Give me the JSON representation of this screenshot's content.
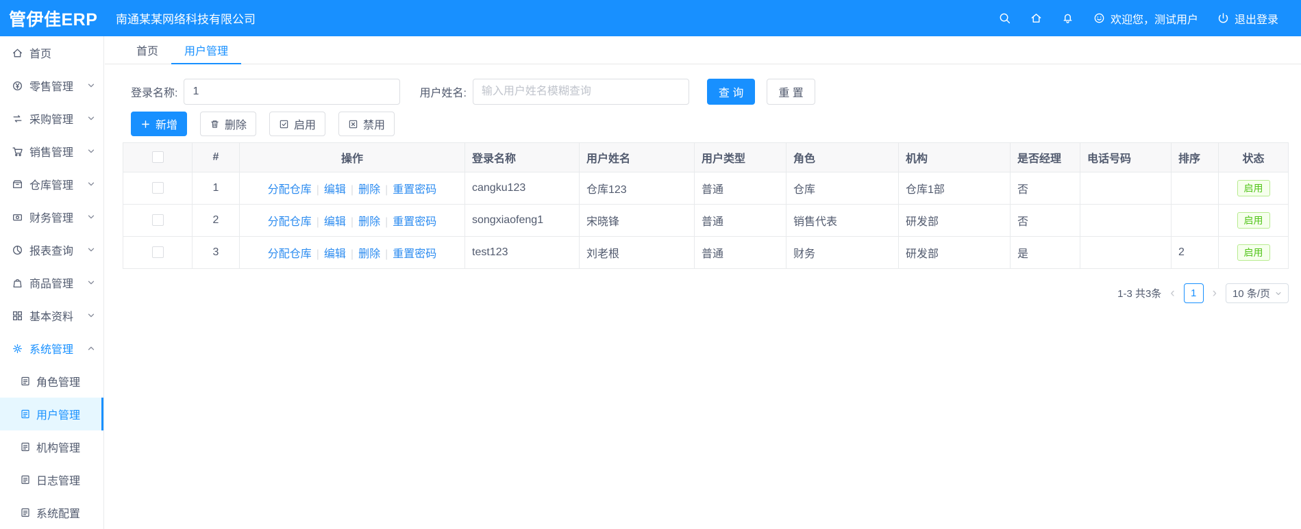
{
  "colors": {
    "primary": "#1890ff",
    "header_bg": "#1890ff",
    "success_text": "#52c41a",
    "active_menu_bg": "#e6f7ff"
  },
  "header": {
    "logo": "管伊佳ERP",
    "company": "南通某某网络科技有限公司",
    "icons": [
      "search-icon",
      "home-icon",
      "bell-icon",
      "smiley-icon",
      "power-icon"
    ],
    "welcome": "欢迎您，测试用户",
    "logout": "退出登录"
  },
  "sidebar": {
    "items": [
      {
        "label": "首页",
        "icon": "home-icon"
      },
      {
        "label": "零售管理",
        "icon": "retail-icon"
      },
      {
        "label": "采购管理",
        "icon": "purchase-icon"
      },
      {
        "label": "销售管理",
        "icon": "sales-cart-icon"
      },
      {
        "label": "仓库管理",
        "icon": "warehouse-icon"
      },
      {
        "label": "财务管理",
        "icon": "finance-icon"
      },
      {
        "label": "报表查询",
        "icon": "report-icon"
      },
      {
        "label": "商品管理",
        "icon": "goods-icon"
      },
      {
        "label": "基本资料",
        "icon": "basic-data-icon"
      },
      {
        "label": "系统管理",
        "icon": "gear-icon",
        "expanded": true,
        "active": true
      }
    ],
    "system_children": [
      {
        "label": "角色管理"
      },
      {
        "label": "用户管理",
        "active": true
      },
      {
        "label": "机构管理"
      },
      {
        "label": "日志管理"
      },
      {
        "label": "系统配置"
      }
    ]
  },
  "tabs": [
    {
      "label": "首页",
      "active": false
    },
    {
      "label": "用户管理",
      "active": true
    }
  ],
  "filters": {
    "login_label": "登录名称:",
    "login_value": "1",
    "name_label": "用户姓名:",
    "name_placeholder": "输入用户姓名模糊查询",
    "search_button": "查 询",
    "reset_button": "重 置"
  },
  "toolbar": {
    "add": "新增",
    "delete": "删除",
    "enable": "启用",
    "disable": "禁用"
  },
  "table": {
    "headers": [
      "#",
      "操作",
      "登录名称",
      "用户姓名",
      "用户类型",
      "角色",
      "机构",
      "是否经理",
      "电话号码",
      "排序",
      "状态"
    ],
    "ops": {
      "assign": "分配仓库",
      "edit": "编辑",
      "delete": "删除",
      "reset": "重置密码",
      "separator": "|"
    },
    "rows": [
      {
        "index": "1",
        "login": "cangku123",
        "name": "仓库123",
        "type": "普通",
        "role": "仓库",
        "org": "仓库1部",
        "manager": "否",
        "phone": "",
        "sort": "",
        "status": "启用"
      },
      {
        "index": "2",
        "login": "songxiaofeng1",
        "name": "宋晓锋",
        "type": "普通",
        "role": "销售代表",
        "org": "研发部",
        "manager": "否",
        "phone": "",
        "sort": "",
        "status": "启用"
      },
      {
        "index": "3",
        "login": "test123",
        "name": "刘老根",
        "type": "普通",
        "role": "财务",
        "org": "研发部",
        "manager": "是",
        "phone": "",
        "sort": "2",
        "status": "启用"
      }
    ]
  },
  "pagination": {
    "total": "1-3 共3条",
    "current_page": "1",
    "page_size": "10 条/页"
  }
}
